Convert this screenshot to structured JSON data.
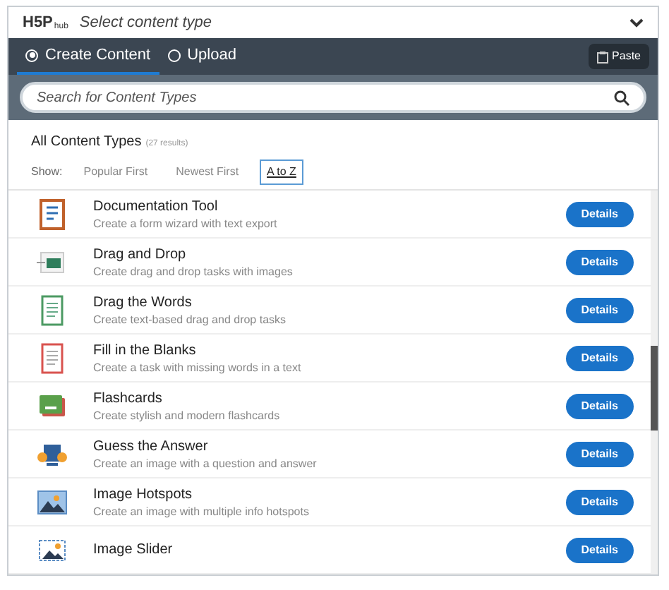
{
  "header": {
    "logo": "H5P",
    "logo_sub": "hub",
    "title": "Select content type",
    "expanded": true
  },
  "tabs": [
    {
      "label": "Create Content",
      "selected": true
    },
    {
      "label": "Upload",
      "selected": false
    }
  ],
  "paste_button": "Paste",
  "search": {
    "placeholder": "Search for Content Types"
  },
  "listing": {
    "title": "All Content Types",
    "count": "(27 results)",
    "show_label": "Show:",
    "sort_options": [
      {
        "label": "Popular First",
        "selected": false
      },
      {
        "label": "Newest First",
        "selected": false
      },
      {
        "label": "A to Z",
        "selected": true
      }
    ]
  },
  "items": [
    {
      "title": "Documentation Tool",
      "description": "Create a form wizard with text export",
      "button": "Details"
    },
    {
      "title": "Drag and Drop",
      "description": "Create drag and drop tasks with images",
      "button": "Details"
    },
    {
      "title": "Drag the Words",
      "description": "Create text-based drag and drop tasks",
      "button": "Details"
    },
    {
      "title": "Fill in the Blanks",
      "description": "Create a task with missing words in a text",
      "button": "Details"
    },
    {
      "title": "Flashcards",
      "description": "Create stylish and modern flashcards",
      "button": "Details"
    },
    {
      "title": "Guess the Answer",
      "description": "Create an image with a question and answer",
      "button": "Details"
    },
    {
      "title": "Image Hotspots",
      "description": "Create an image with multiple info hotspots",
      "button": "Details"
    },
    {
      "title": "Image Slider",
      "button": "Details"
    }
  ]
}
